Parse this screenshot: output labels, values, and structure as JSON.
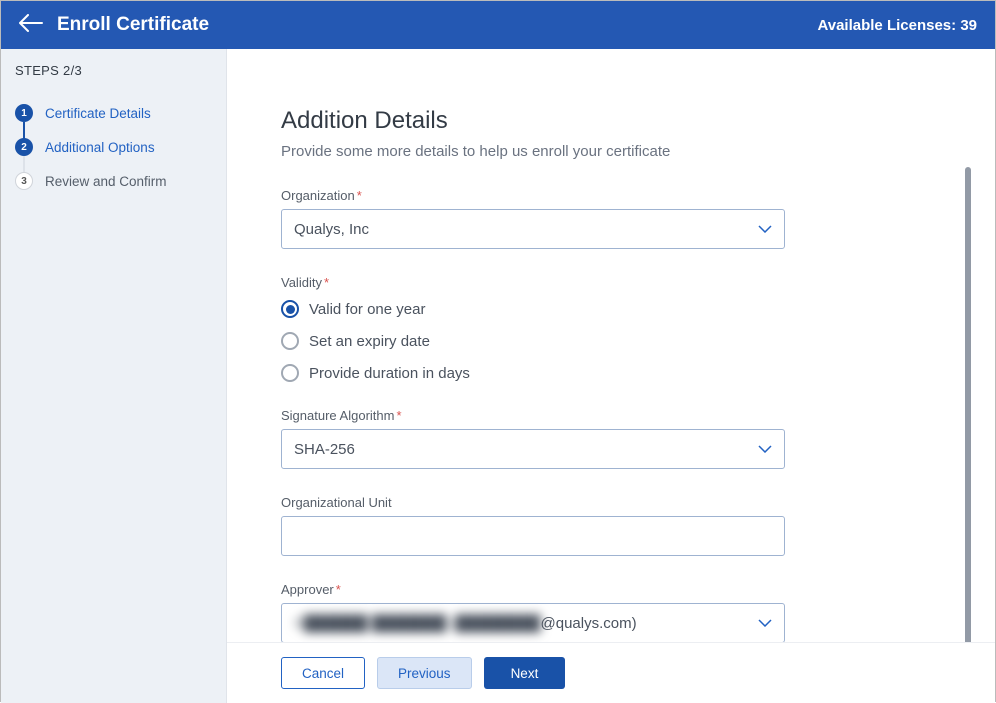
{
  "header": {
    "title": "Enroll Certificate",
    "licenses_label": "Available Licenses: 39"
  },
  "sidebar": {
    "steps_label": "STEPS 2/3",
    "items": [
      {
        "num": "1",
        "label": "Certificate Details"
      },
      {
        "num": "2",
        "label": "Additional Options"
      },
      {
        "num": "3",
        "label": "Review and Confirm"
      }
    ]
  },
  "form": {
    "title": "Addition Details",
    "subtitle": "Provide some more details to help us enroll your certificate",
    "org_label": "Organization",
    "org_value": "Qualys, Inc",
    "validity_label": "Validity",
    "validity_options": [
      {
        "label": "Valid for one year",
        "selected": true
      },
      {
        "label": "Set an expiry date",
        "selected": false
      },
      {
        "label": "Provide duration in days",
        "selected": false
      }
    ],
    "sig_label": "Signature Algorithm",
    "sig_value": "SHA-256",
    "ou_label": "Organizational Unit",
    "ou_value": "",
    "approver_label": "Approver",
    "approver_blurred": "S██████ ███████ (████████",
    "approver_visible": "@qualys.com)"
  },
  "buttons": {
    "cancel": "Cancel",
    "previous": "Previous",
    "next": "Next"
  }
}
